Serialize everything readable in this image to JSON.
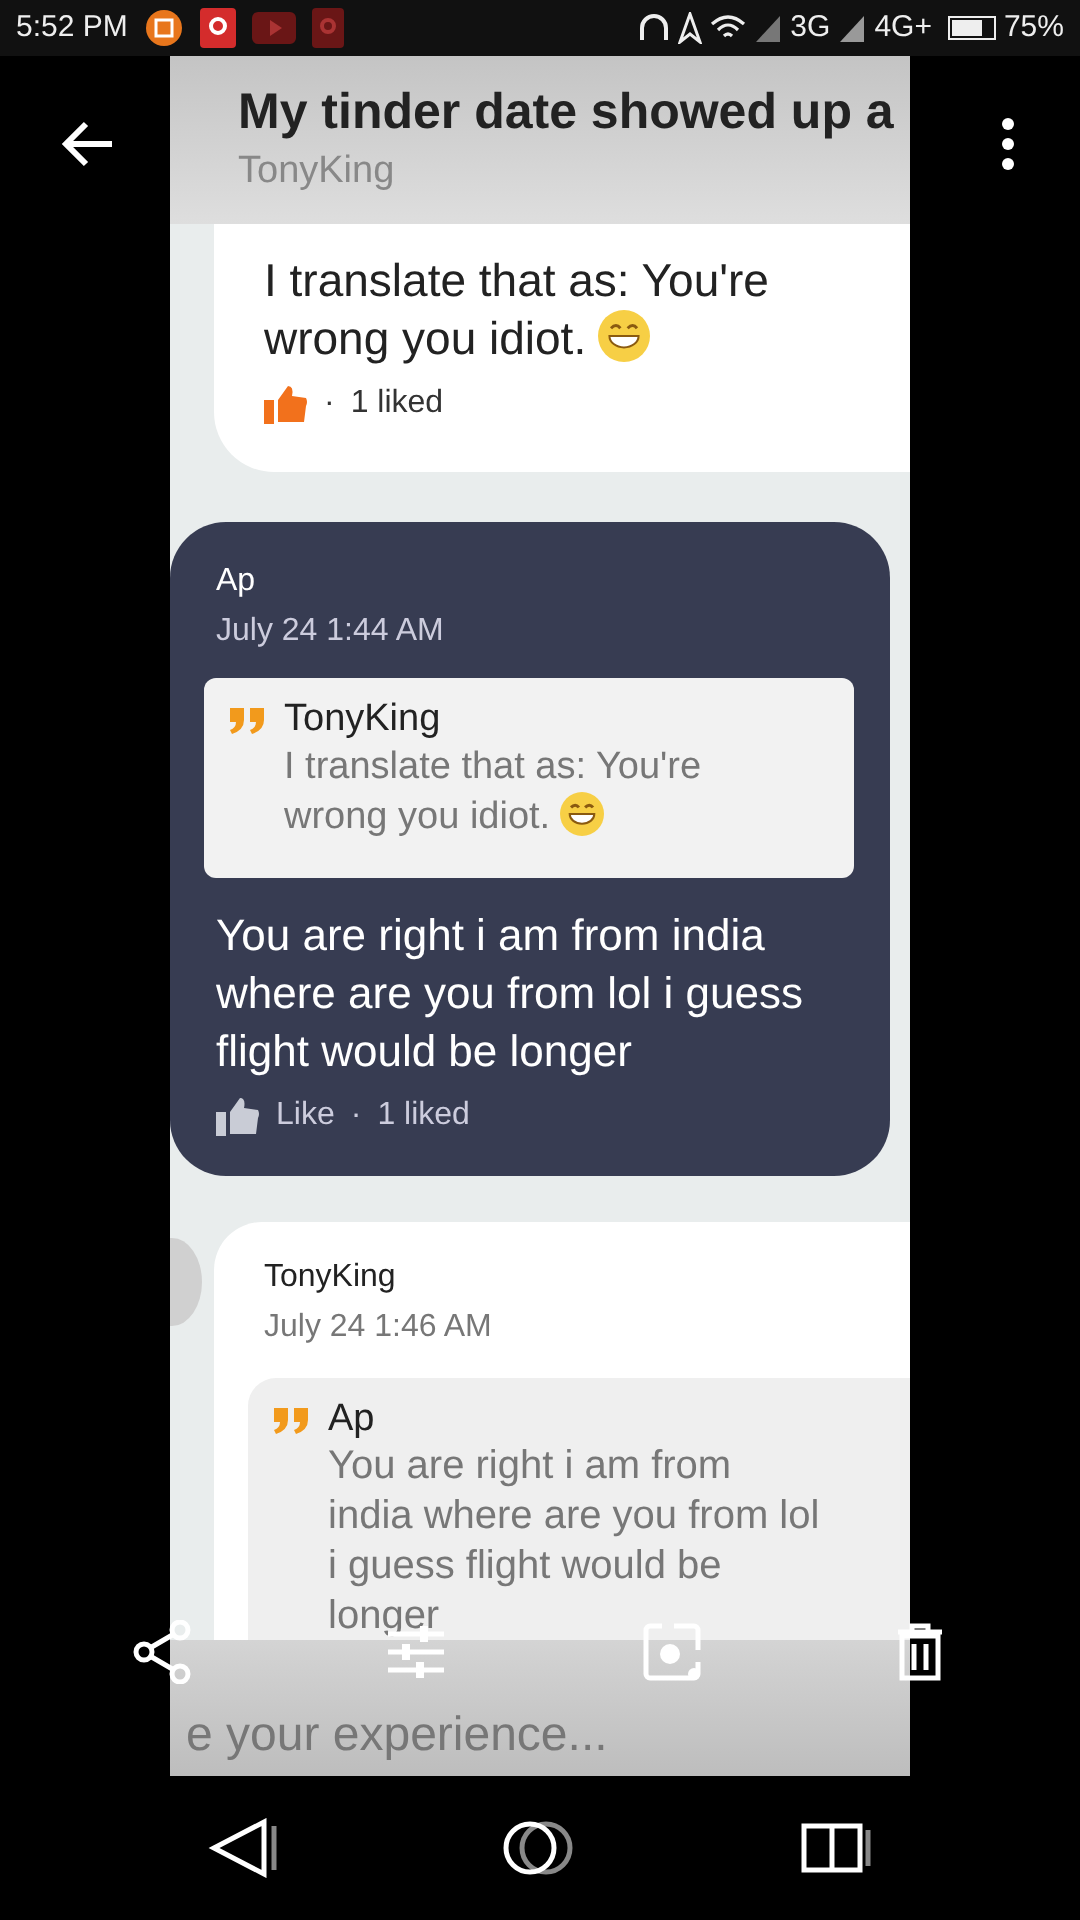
{
  "status_bar": {
    "time": "5:52 PM",
    "network_1": "3G",
    "network_2": "4G+",
    "battery": "75%"
  },
  "screenshot": {
    "title": "My tinder date showed up a",
    "author": "TonyKing",
    "posts": [
      {
        "kind": "tail",
        "text": "I translate that as: You're wrong you idiot.",
        "emoji": true,
        "liked": true,
        "separator": "·",
        "likes": "1 liked"
      },
      {
        "kind": "dark",
        "author": "Ap",
        "time": "July 24 1:44 AM",
        "quote": {
          "author": "TonyKing",
          "text": "I translate that as: You're wrong you idiot.",
          "emoji": true
        },
        "text": "You are right i am from india where are you from lol i guess flight would be longer",
        "emoji": false,
        "liked": false,
        "like_label": "Like",
        "separator": "·",
        "likes": "1 liked"
      },
      {
        "kind": "light",
        "author": "TonyKing",
        "time": "July 24 1:46 AM",
        "quote": {
          "author": "Ap",
          "text": "You are right i am from india where are you from lol i guess flight would be longer",
          "emoji": false
        }
      }
    ],
    "comment_placeholder": "e your experience..."
  }
}
